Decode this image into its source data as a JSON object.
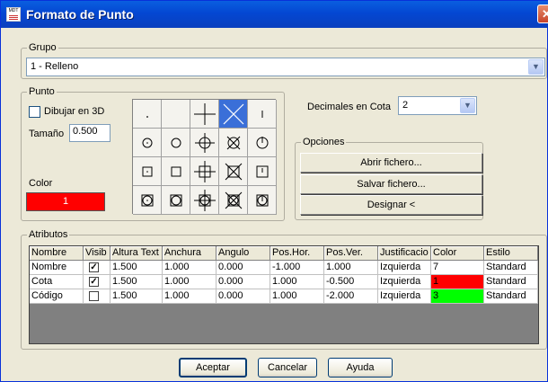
{
  "window": {
    "title": "Formato de Punto",
    "icon_text": "MDT"
  },
  "grupo": {
    "legend": "Grupo",
    "value": "1 - Relleno"
  },
  "punto": {
    "legend": "Punto",
    "dibujar_3d_label": "Dibujar en 3D",
    "dibujar_3d_checked": false,
    "tamano_label": "Tamaño",
    "tamano_value": "0.500",
    "color_label": "Color",
    "color_value": "1",
    "color_hex": "#ff0000",
    "selected_symbol_index": 3
  },
  "decimales": {
    "label": "Decimales en Cota",
    "value": "2"
  },
  "opciones": {
    "legend": "Opciones",
    "abrir": "Abrir fichero...",
    "salvar": "Salvar fichero...",
    "designar": "Designar <"
  },
  "atributos": {
    "legend": "Atributos",
    "columns": [
      "Nombre",
      "Visib",
      "Altura Text",
      "Anchura",
      "Angulo",
      "Pos.Hor.",
      "Pos.Ver.",
      "Justificacio",
      "Color",
      "Estilo"
    ],
    "rows": [
      {
        "nombre": "Nombre",
        "visible": true,
        "altura": "1.500",
        "anchura": "1.000",
        "angulo": "0.000",
        "pos_hor": "-1.000",
        "pos_ver": "1.000",
        "justificacion": "Izquierda",
        "color": "7",
        "color_hex": "#ffffff",
        "estilo": "Standard"
      },
      {
        "nombre": "Cota",
        "visible": true,
        "altura": "1.500",
        "anchura": "1.000",
        "angulo": "0.000",
        "pos_hor": "1.000",
        "pos_ver": "-0.500",
        "justificacion": "Izquierda",
        "color": "1",
        "color_hex": "#ff0000",
        "estilo": "Standard"
      },
      {
        "nombre": "Código",
        "visible": false,
        "altura": "1.500",
        "anchura": "1.000",
        "angulo": "0.000",
        "pos_hor": "1.000",
        "pos_ver": "-2.000",
        "justificacion": "Izquierda",
        "color": "3",
        "color_hex": "#00ff00",
        "estilo": "Standard"
      }
    ]
  },
  "buttons": {
    "aceptar": "Aceptar",
    "cancelar": "Cancelar",
    "ayuda": "Ayuda"
  }
}
